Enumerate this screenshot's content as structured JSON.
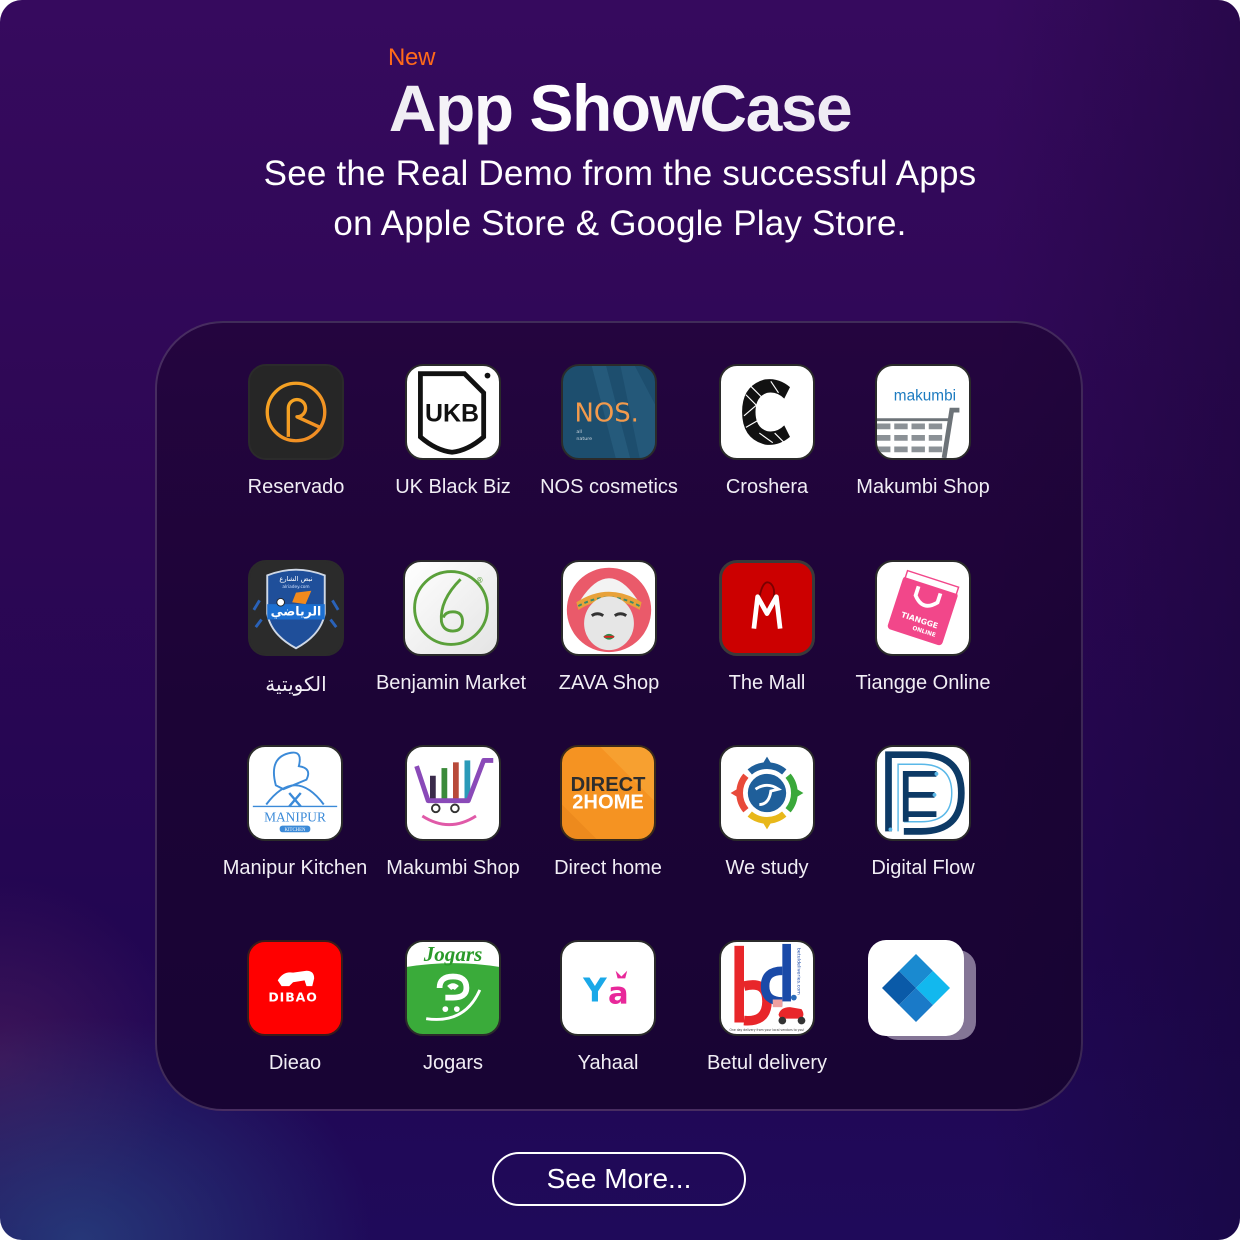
{
  "header": {
    "badge": "New",
    "title": "App ShowCase",
    "subtitle_line1": "See the Real Demo from the successful Apps",
    "subtitle_line2": "on Apple Store & Google Play Store."
  },
  "colors": {
    "badge": "#ff6a1a",
    "background_top": "#360a5e",
    "background_bottom": "#1f0a5a",
    "panel": "#1c0436"
  },
  "apps": [
    {
      "name": "Reservado",
      "icon": "reservado-icon"
    },
    {
      "name": "UK Black Biz",
      "icon": "ukb-icon",
      "icon_text": "UKB"
    },
    {
      "name": "NOS cosmetics",
      "icon": "nos-icon",
      "icon_text": "NOS.",
      "icon_subtext1": "all",
      "icon_subtext2": "nature"
    },
    {
      "name": "Croshera",
      "icon": "croshera-icon",
      "icon_text": "C"
    },
    {
      "name": "Makumbi Shop",
      "icon": "makumbi-cart-icon",
      "icon_text": "makumbi"
    },
    {
      "name": "الكويتية",
      "icon": "alriadey-icon",
      "icon_text": "الرياضي",
      "icon_subtext1": "نبض الشارع",
      "icon_subtext2": "alriadey.com"
    },
    {
      "name": "Benjamin Market",
      "icon": "benjamin-icon",
      "icon_text": "6",
      "icon_subtext1": "®"
    },
    {
      "name": "ZAVA Shop",
      "icon": "zava-mask-icon"
    },
    {
      "name": "The Mall",
      "icon": "the-mall-icon",
      "icon_text": "M"
    },
    {
      "name": "Tiangge Online",
      "icon": "tiangge-bag-icon",
      "icon_text": "TIANGGE",
      "icon_subtext1": "ONLINE"
    },
    {
      "name": "Manipur Kitchen",
      "icon": "manipur-chef-icon",
      "icon_text": "MANIPUR",
      "icon_subtext1": "KITCHEN"
    },
    {
      "name": "Makumbi Shop",
      "icon": "makumbi-smile-cart-icon"
    },
    {
      "name": "Direct home",
      "icon": "direct2home-icon",
      "icon_text": "DIRECT",
      "icon_subtext1": "2HOME"
    },
    {
      "name": "We study",
      "icon": "we-study-compass-icon"
    },
    {
      "name": "Digital Flow",
      "icon": "digital-flow-icon"
    },
    {
      "name": "Dieao",
      "icon": "dibao-lion-icon",
      "icon_text": "DIBAO"
    },
    {
      "name": "Jogars",
      "icon": "jogars-cart-icon",
      "icon_text": "Jogars"
    },
    {
      "name": "Yahaal",
      "icon": "yahaal-icon",
      "icon_text": "Ya"
    },
    {
      "name": "Betul delivery",
      "icon": "betul-delivery-icon",
      "icon_text": "bd",
      "icon_subtext1": "betuldeliveries.com",
      "icon_subtext2": "One day delivery from your local vendors to you!"
    },
    {
      "name": "",
      "icon": "more-apps-stack-icon"
    }
  ],
  "footer": {
    "see_more_label": "See More..."
  }
}
